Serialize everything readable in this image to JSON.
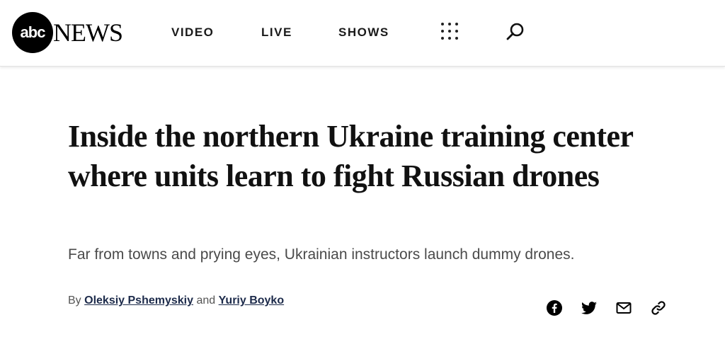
{
  "header": {
    "logo": {
      "mark": "abc",
      "wordmark": "NEWS"
    },
    "nav": [
      {
        "label": "VIDEO"
      },
      {
        "label": "LIVE"
      },
      {
        "label": "SHOWS"
      }
    ],
    "menu_icon": "grid-menu-icon",
    "search_icon": "search-icon"
  },
  "article": {
    "headline": "Inside the northern Ukraine training center where units learn to fight Russian drones",
    "subheadline": "Far from towns and prying eyes, Ukrainian instructors launch dummy drones.",
    "byline": {
      "prefix": "By",
      "author1": "Oleksiy Pshemyskiy",
      "conjunction": "and",
      "author2": "Yuriy Boyko"
    }
  },
  "share_icons": [
    "facebook-icon",
    "twitter-icon",
    "email-icon",
    "link-icon"
  ]
}
